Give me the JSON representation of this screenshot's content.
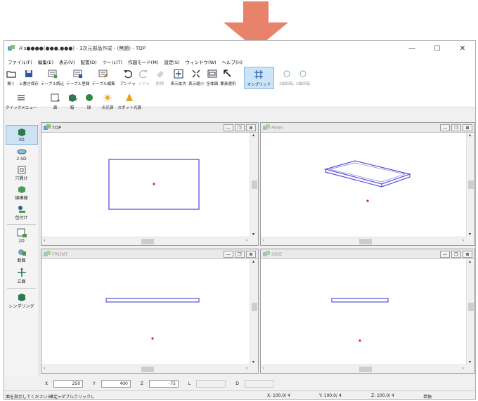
{
  "window": {
    "title": "A's●●●●(●●●,●●●) - 3次元部品作成 - (無題) - TOP",
    "minimize": "—",
    "maximize": "☐",
    "close": "✕"
  },
  "menu": [
    "ファイル(F)",
    "編集(E)",
    "表示(V)",
    "配置(D)",
    "ツール(T)",
    "作図モード(M)",
    "設定(S)",
    "ウィンドウ(W)",
    "ヘルプ(H)"
  ],
  "toolbar1": {
    "open": "開く",
    "overwrite_save": "上書き保存",
    "table_load": "テーブル読込",
    "table_register": "テーブル登録",
    "table_edit": "テーブル編集",
    "undo": "アンドゥ",
    "redo": "リドゥ",
    "delete": "削除",
    "zoom_in": "表示拡大",
    "zoom_out": "表示縮小",
    "fit_all": "全体図",
    "select_element": "要素選択",
    "on_grid": "オングリッド",
    "x_rotate": "X軸回転",
    "x_rotate2": "X軸回転"
  },
  "toolbar2": {
    "quick_menu": "クイックメニュー",
    "face": "面",
    "box": "箱",
    "sphere": "球",
    "point_light": "点光源",
    "spot_light": "スポット光源"
  },
  "sidebar": {
    "s3d": "3D",
    "s25d": "2.5D",
    "hole": "穴開け",
    "thread": "線模様",
    "coloring": "色付け",
    "s2d": "2D",
    "section": "断面",
    "elevation": "立面",
    "rendering": "レンダリング"
  },
  "viewports": {
    "top": "TOP",
    "pers": "PERS",
    "front": "FRONT",
    "side": "SIDE"
  },
  "coords": {
    "x_label": "X",
    "x_value": "250",
    "y_label": "Y",
    "y_value": "400",
    "z_label": "Z",
    "z_value": "-75",
    "l_label": "L",
    "d_label": "D"
  },
  "status": {
    "message": "面を指示してください(確定=ダブルクリック)。",
    "x": "X: 100.0/ 4",
    "y": "Y: 100.0/ 4",
    "z": "Z: 100.0/ 4",
    "mode": "単独"
  },
  "colors": {
    "arrow": "#e8826a",
    "outline": "#5a50d8",
    "point": "#e02020"
  },
  "scroll_glyphs": {
    "up": "▴",
    "down": "▾",
    "left": "‹",
    "right": "›"
  }
}
